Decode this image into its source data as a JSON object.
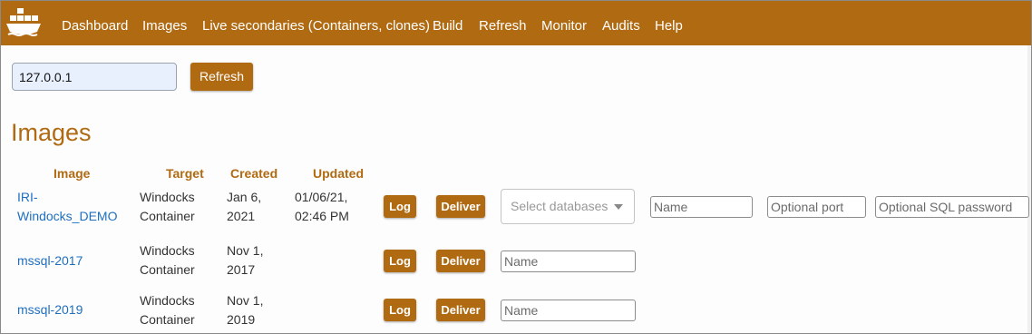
{
  "colors": {
    "brand": "#b06a12",
    "link": "#1f6fbf",
    "input_bg": "#e8f0fe"
  },
  "nav": {
    "logo_icon": "docker-whale-icon",
    "items": [
      {
        "label": "Dashboard"
      },
      {
        "label": "Images"
      },
      {
        "label": "Live secondaries (Containers, clones)"
      },
      {
        "label": "Build"
      },
      {
        "label": "Refresh"
      },
      {
        "label": "Monitor"
      },
      {
        "label": "Audits"
      },
      {
        "label": "Help"
      }
    ]
  },
  "host": {
    "value": "127.0.0.1",
    "refresh_label": "Refresh"
  },
  "page_title": "Images",
  "table": {
    "headers": {
      "image": "Image",
      "target": "Target",
      "created": "Created",
      "updated": "Updated"
    },
    "rows": [
      {
        "image_line1": "IRI-",
        "image_line2": "Windocks_DEMO",
        "target_line1": "Windocks",
        "target_line2": "Container",
        "created_line1": "Jan 6,",
        "created_line2": "2021",
        "updated_line1": "01/06/21,",
        "updated_line2": "02:46 PM",
        "log_label": "Log",
        "deliver_label": "Deliver",
        "select_placeholder": "Select databases",
        "name_placeholder": "Name",
        "port_placeholder": "Optional port",
        "sql_password_placeholder": "Optional SQL password"
      },
      {
        "image_line1": "mssql-2017",
        "target_line1": "Windocks",
        "target_line2": "Container",
        "created_line1": "Nov 1,",
        "created_line2": "2017",
        "log_label": "Log",
        "deliver_label": "Deliver",
        "name_placeholder": "Name"
      },
      {
        "image_line1": "mssql-2019",
        "target_line1": "Windocks",
        "target_line2": "Container",
        "created_line1": "Nov 1,",
        "created_line2": "2019",
        "log_label": "Log",
        "deliver_label": "Deliver",
        "name_placeholder": "Name"
      }
    ]
  }
}
